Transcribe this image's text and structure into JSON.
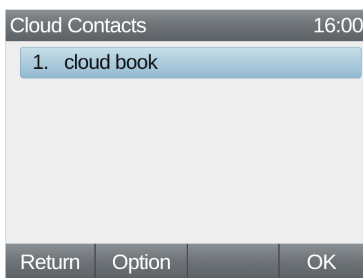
{
  "header": {
    "title": "Cloud Contacts",
    "time": "16:00"
  },
  "list": {
    "items": [
      {
        "index": "1.",
        "label": "cloud book",
        "selected": true
      }
    ]
  },
  "softkeys": {
    "return_label": "Return",
    "option_label": "Option",
    "blank_label": "",
    "ok_label": "OK"
  },
  "colors": {
    "titlebar": "#6f7478",
    "content_bg": "#eeeeee",
    "selection": "#a9cadb",
    "softkey_bar": "#6e7377"
  }
}
